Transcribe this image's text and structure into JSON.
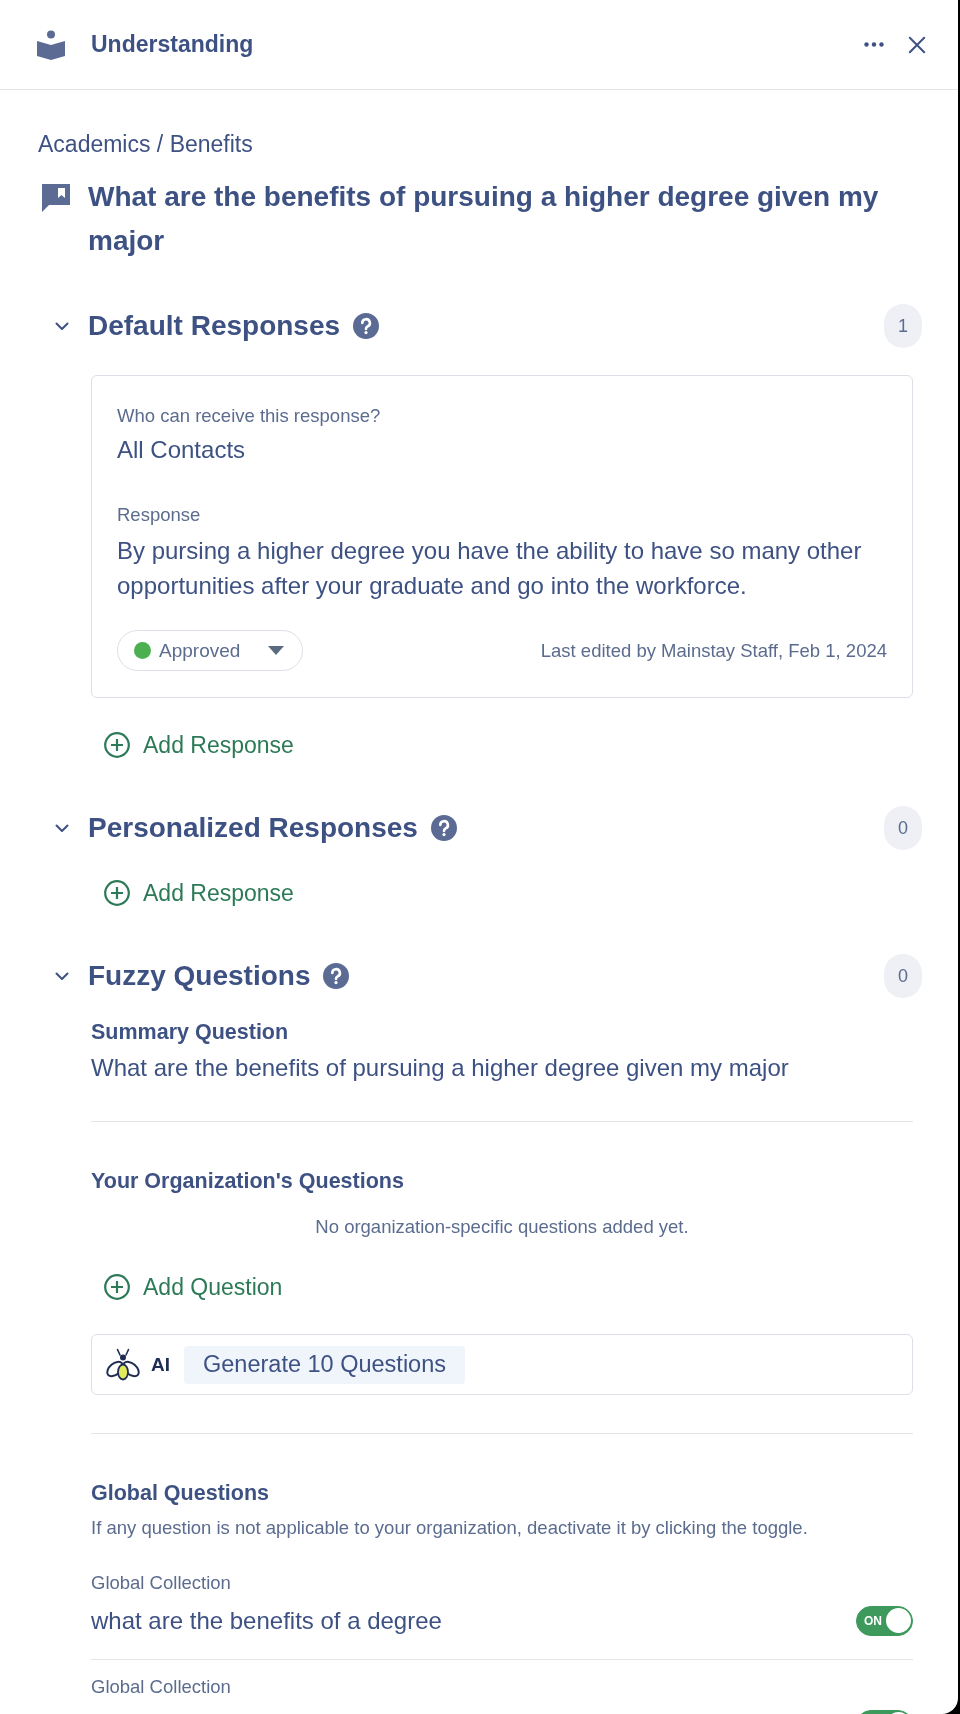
{
  "panel": {
    "title": "Understanding"
  },
  "breadcrumb": "Academics / Benefits",
  "question_title": "What are the benefits of pursuing a higher degree given my major",
  "sections": [
    {
      "kind": "responses",
      "title": "Default Responses",
      "expanded": true,
      "count": "1",
      "responses": [
        {
          "audience_label": "Who can receive this response?",
          "audience": "All Contacts",
          "response_label": "Response",
          "text": "By pursing a higher degree you have the ability to have so many other opportunities after your graduate and go into the workforce.",
          "status": {
            "label": "Approved",
            "color": "#4caf50"
          },
          "last_edited": "Last edited by Mainstay Staff, Feb 1, 2024"
        }
      ],
      "add_label": "Add Response"
    },
    {
      "kind": "responses",
      "title": "Personalized Responses",
      "expanded": true,
      "count": "0",
      "add_label": "Add Response"
    },
    {
      "kind": "fuzzy",
      "title": "Fuzzy Questions",
      "expanded": true,
      "count": "0",
      "summary": {
        "heading": "Summary Question",
        "text": "What are the benefits of pursuing a higher degree given my major"
      },
      "organization": {
        "heading": "Your Organization's Questions",
        "empty_text": "No organization-specific questions added yet.",
        "add_label": "Add Question",
        "ai_label": "AI",
        "generate_label": "Generate 10 Questions"
      },
      "global": {
        "heading": "Global Questions",
        "description": "If any question is not applicable to your organization, deactivate it by clicking the toggle.",
        "items": [
          {
            "collection": "Global Collection",
            "question": "what are the benefits of a degree",
            "on": true,
            "toggle_label": "ON"
          },
          {
            "collection": "Global Collection",
            "on": true
          }
        ]
      }
    }
  ]
}
